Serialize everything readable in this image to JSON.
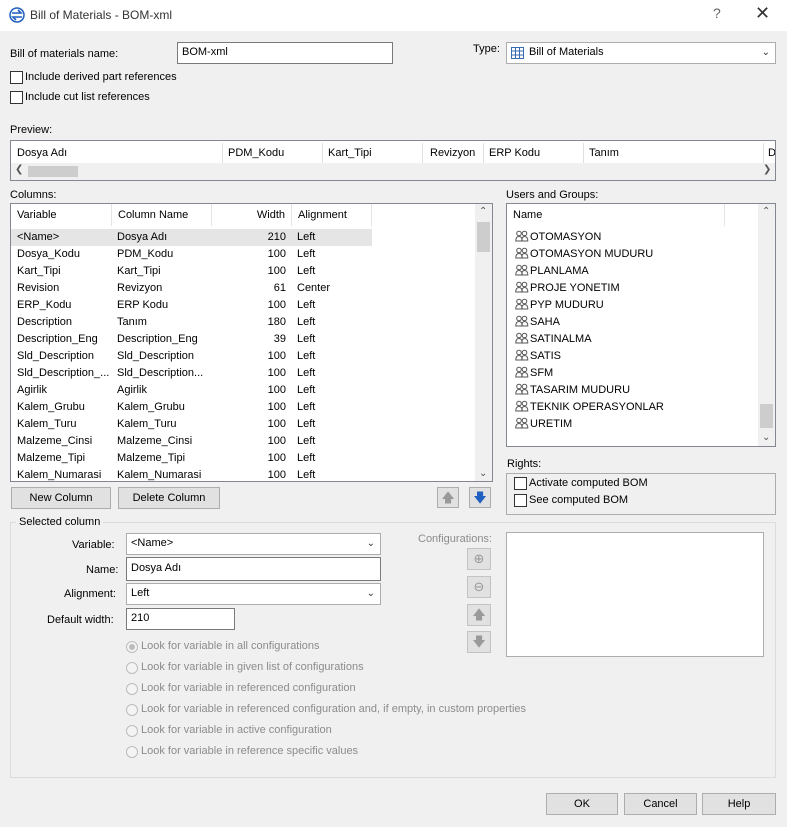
{
  "window": {
    "title": "Bill of Materials - BOM-xml",
    "help_symbol": "?",
    "close_symbol": "✕"
  },
  "bom_name": {
    "label": "Bill of materials name:",
    "value": "BOM-xml"
  },
  "type": {
    "label": "Type:",
    "value": "Bill of Materials"
  },
  "options": {
    "derived": "Include derived part references",
    "cutlist": "Include cut list references"
  },
  "preview": {
    "label": "Preview:",
    "headers": [
      "Dosya Adı",
      "PDM_Kodu",
      "Kart_Tipi",
      "Revizyon",
      "ERP Kodu",
      "Tanım",
      "D"
    ]
  },
  "columns": {
    "label": "Columns:",
    "headers": [
      "Variable",
      "Column Name",
      "Width",
      "Alignment"
    ],
    "rows": [
      [
        "<Name>",
        "Dosya Adı",
        "210",
        "Left"
      ],
      [
        "Dosya_Kodu",
        "PDM_Kodu",
        "100",
        "Left"
      ],
      [
        "Kart_Tipi",
        "Kart_Tipi",
        "100",
        "Left"
      ],
      [
        "Revision",
        "Revizyon",
        "61",
        "Center"
      ],
      [
        "ERP_Kodu",
        "ERP Kodu",
        "100",
        "Left"
      ],
      [
        "Description",
        "Tanım",
        "180",
        "Left"
      ],
      [
        "Description_Eng",
        "Description_Eng",
        "39",
        "Left"
      ],
      [
        "Sld_Description",
        "Sld_Description",
        "100",
        "Left"
      ],
      [
        "Sld_Description_...",
        "Sld_Description...",
        "100",
        "Left"
      ],
      [
        "Agirlik",
        "Agirlik",
        "100",
        "Left"
      ],
      [
        "Kalem_Grubu",
        "Kalem_Grubu",
        "100",
        "Left"
      ],
      [
        "Kalem_Turu",
        "Kalem_Turu",
        "100",
        "Left"
      ],
      [
        "Malzeme_Cinsi",
        "Malzeme_Cinsi",
        "100",
        "Left"
      ],
      [
        "Malzeme_Tipi",
        "Malzeme_Tipi",
        "100",
        "Left"
      ],
      [
        "Kalem_Numarasi",
        "Kalem_Numarasi",
        "100",
        "Left"
      ]
    ],
    "new_button": "New Column",
    "delete_button": "Delete Column"
  },
  "users": {
    "label": "Users and Groups:",
    "header": "Name",
    "items": [
      "OTOMASYON",
      "OTOMASYON MUDURU",
      "PLANLAMA",
      "PROJE YONETIM",
      "PYP MUDURU",
      "SAHA",
      "SATINALMA",
      "SATIS",
      "SFM",
      "TASARIM MUDURU",
      "TEKNIK OPERASYONLAR",
      "URETIM"
    ]
  },
  "rights": {
    "label": "Rights:",
    "activate": "Activate computed BOM",
    "see": "See computed BOM"
  },
  "selected": {
    "legend": "Selected column",
    "variable_label": "Variable:",
    "variable_value": "<Name>",
    "name_label": "Name:",
    "name_value": "Dosya Adı",
    "alignment_label": "Alignment:",
    "alignment_value": "Left",
    "width_label": "Default width:",
    "width_value": "210",
    "configurations_label": "Configurations:",
    "radios": [
      "Look for variable in all configurations",
      "Look for variable in given list of configurations",
      "Look for variable in referenced configuration",
      "Look for variable in referenced configuration and, if empty, in custom properties",
      "Look for variable in active configuration",
      "Look for variable in reference specific values"
    ]
  },
  "footer": {
    "ok": "OK",
    "cancel": "Cancel",
    "help": "Help"
  },
  "colors": {
    "selected_row": "#e5e5e5",
    "accent_arrow": "#1f5fbf"
  }
}
